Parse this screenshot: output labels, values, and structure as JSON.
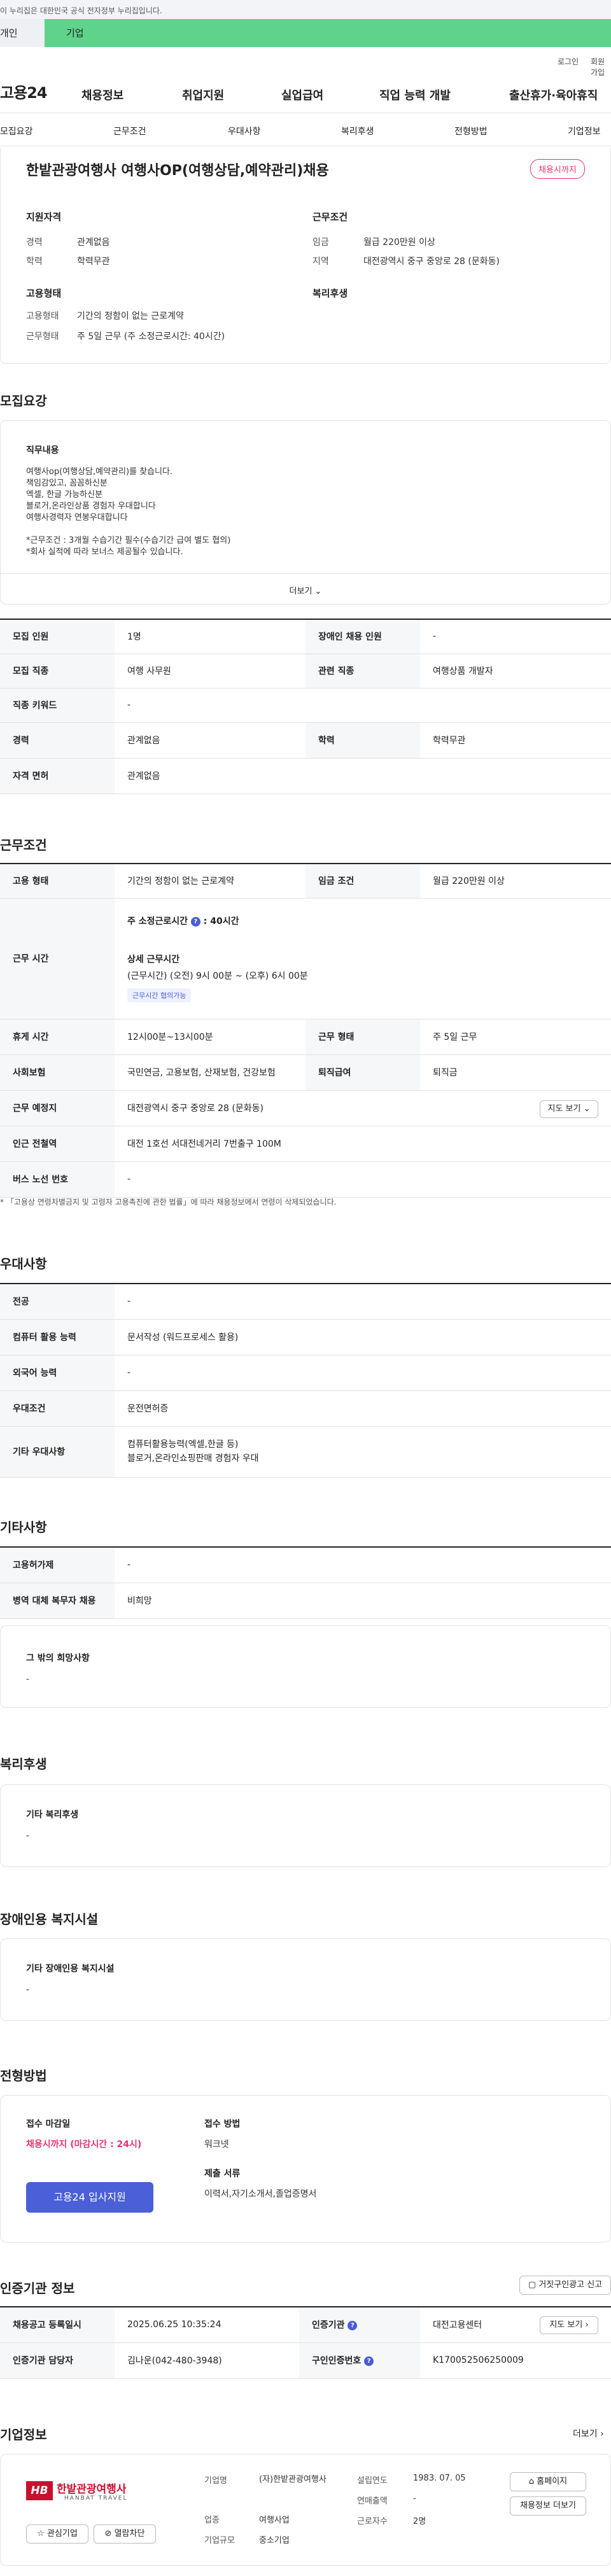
{
  "gov_banner": "이 누리집은 대한민국 공식 전자정부 누리집입니다.",
  "categories": [
    "개인",
    "기업"
  ],
  "util": {
    "login": "로그인",
    "join": "회원가입"
  },
  "logo": "고용24",
  "gnb": [
    "채용정보",
    "취업지원",
    "실업급여",
    "직업 능력 개발",
    "출산휴가·육아휴직"
  ],
  "snb": [
    "모집요강",
    "근무조건",
    "우대사항",
    "복리후생",
    "전형방법",
    "기업정보"
  ],
  "job_title": "한밭관광여행사 여행사OP(여행상담,예약관리)채용",
  "status_badge": "채용시까지",
  "summary": {
    "qual_title": "지원자격",
    "career_label": "경력",
    "career_value": "관계없음",
    "edu_label": "학력",
    "edu_value": "학력무관",
    "cond_title": "근무조건",
    "wage_label": "임금",
    "wage_value": "월급 220만원 이상",
    "region_label": "지역",
    "region_value": "대전광역시 중구 중앙로 28 (문화동)",
    "emp_title": "고용형태",
    "emp_type_label": "고용형태",
    "emp_type_value": "기간의 정함이 없는 근로계약",
    "work_type_label": "근무형태",
    "work_type_value": "주 5일 근무 (주 소정근로시간: 40시간)",
    "welfare_title": "복리후생"
  },
  "recruit": {
    "heading": "모집요강",
    "duty_title": "직무내용",
    "duty_lines": [
      "여행사op(여행상담,예약관리)를 찾습니다.",
      "책임감있고, 꼼꼼하신분",
      "엑셀, 한글 가능하신분",
      "블로거,온라인상품 경험자 우대합니다",
      "여행사경력자 연봉우대합니다",
      "",
      "*근무조건 : 3개월 수습기간 필수(수습기간 급여 별도 협의)",
      "*회사 실적에 따라 보너스 제공될수 있습니다."
    ],
    "more": "더보기",
    "rows": [
      [
        "모집 인원",
        "1명",
        "장애인 채용 인원",
        "-"
      ],
      [
        "모집 직종",
        "여행 사무원",
        "관련 직종",
        "여행상품 개발자"
      ],
      [
        "직종 키워드",
        "-"
      ],
      [
        "경력",
        "관계없음",
        "학력",
        "학력무관"
      ],
      [
        "자격 면허",
        "관계없음"
      ]
    ]
  },
  "work": {
    "heading": "근무조건",
    "emp_label": "고용 형태",
    "emp_value": "기간의 정함이 없는 근로계약",
    "wage_label": "임금 조건",
    "wage_value": "월급 220만원 이상",
    "time_label": "근무 시간",
    "std_hours": "주 소정근로시간 ",
    "std_hours_value": "40시간",
    "detail_title": "상세 근무시간",
    "detail_value": "(근무시간) (오전) 9시 00분 ~ (오후) 6시 00분",
    "tag": "근무시간 협의가능",
    "rest_label": "휴게 시간",
    "rest_value": "12시00분~13시00분",
    "shift_label": "근무 형태",
    "shift_value": "주 5일 근무",
    "ins_label": "사회보험",
    "ins_value": "국민연금, 고용보험, 산재보험, 건강보험",
    "sev_label": "퇴직급여",
    "sev_value": "퇴직금",
    "loc_label": "근무 예정지",
    "loc_value": "대전광역시 중구 중앙로 28 (문화동)",
    "map_btn": "지도 보기",
    "sub_label": "인근 전철역",
    "sub_value": "대전 1호선 서대전네거리 7번출구 100M",
    "bus_label": "버스 노선 번호",
    "bus_value": "-",
    "note": "* 「고용상 연령차별금지 및 고령자 고용촉진에 관한 법률」에 따라 채용정보에서 연령이 삭제되었습니다."
  },
  "pref": {
    "heading": "우대사항",
    "rows": [
      [
        "전공",
        "-"
      ],
      [
        "컴퓨터 활용 능력",
        "문서작성 (워드프로세스 활용)"
      ],
      [
        "외국어 능력",
        "-"
      ],
      [
        "우대조건",
        "운전면허증"
      ]
    ],
    "etc_label": "기타 우대사항",
    "etc_lines": [
      "컴퓨터활용능력(엑셀,한글 등)",
      "블로거,온라인쇼핑판매 경험자 우대"
    ]
  },
  "other": {
    "heading": "기타사항",
    "rows": [
      [
        "고용허가제",
        "-"
      ],
      [
        "병역 대체 복무자 채용",
        "비희망"
      ]
    ],
    "box_title": "그 밖의 희망사항",
    "box_value": "-"
  },
  "welfare": {
    "heading": "복리후생",
    "box_title": "기타 복리후생",
    "box_value": "-"
  },
  "disability": {
    "heading": "장애인용 복지시설",
    "box_title": "기타 장애인용 복지시설",
    "box_value": "-"
  },
  "process": {
    "heading": "전형방법",
    "deadline_title": "접수 마감일",
    "deadline_value": "채용시까지 (마감시간 : 24시)",
    "apply_btn": "고용24 입사지원",
    "method_title": "접수 방법",
    "method_value": "워크넷",
    "docs_title": "제출 서류",
    "docs_value": "이력서,자기소개서,졸업증명서"
  },
  "cert": {
    "heading": "인증기관 정보",
    "report_btn": "거짓구인광고 신고",
    "reg_label": "채용공고 등록일시",
    "reg_value": "2025.06.25 10:35:24",
    "org_label": "인증기관",
    "org_value": "대전고용센터",
    "map_btn": "지도 보기",
    "mgr_label": "인증기관 담당자",
    "mgr_value": "김나운(042-480-3948)",
    "no_label": "구인인증번호",
    "no_value": "K170052506250009"
  },
  "company": {
    "heading": "기업정보",
    "more": "더보기",
    "logo_main": "한밭관광여행사",
    "logo_sub": "HANBAT TRAVEL",
    "fav_btn": "관심기업",
    "block_btn": "열람차단",
    "name_label": "기업명",
    "name_value": "(자)한밭관광여행사",
    "ind_label": "업종",
    "ind_value": "여행사업",
    "size_label": "기업규모",
    "size_value": "중소기업",
    "found_label": "설립연도",
    "found_value": "1983. 07. 05",
    "sales_label": "연매출액",
    "sales_value": "-",
    "emp_label": "근로자수",
    "emp_value": "2명",
    "home_btn": "홈페이지",
    "list_btn": "채용정보 더보기"
  }
}
